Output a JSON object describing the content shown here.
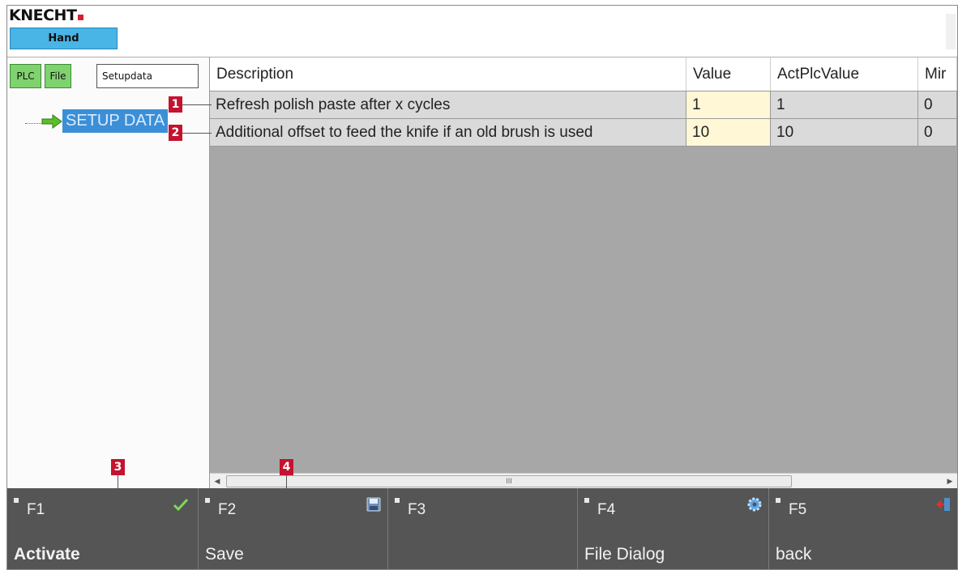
{
  "header": {
    "brand": "KNECHT",
    "mode": "Hand"
  },
  "tree_panel": {
    "plc_button": "PLC",
    "file_button": "File",
    "setup_tab": "Setupdata",
    "root_node": "SETUP DATA"
  },
  "table": {
    "columns": [
      "Description",
      "Value",
      "ActPlcValue",
      "Mir"
    ],
    "rows": [
      {
        "description": "Refresh polish paste after x cycles",
        "value": "1",
        "act": "1",
        "min": "0"
      },
      {
        "description": "Additional offset to feed the knife if an old brush is used",
        "value": "10",
        "act": "10",
        "min": "0"
      }
    ]
  },
  "scrollbar": {
    "thumb_grip": "III"
  },
  "callouts": [
    "1",
    "2",
    "3",
    "4"
  ],
  "function_keys": [
    {
      "key": "F1",
      "label": "Activate",
      "icon": "check-icon"
    },
    {
      "key": "F2",
      "label": "Save",
      "icon": "floppy-icon"
    },
    {
      "key": "F3",
      "label": "",
      "icon": ""
    },
    {
      "key": "F4",
      "label": "File Dialog",
      "icon": "gear-icon"
    },
    {
      "key": "F5",
      "label": "back",
      "icon": "exit-door-icon"
    }
  ],
  "colors": {
    "mode_badge": "#49b4e6",
    "green_button": "#7fd36e",
    "tree_selection": "#3c8fd6",
    "value_cell": "#fff7d6",
    "function_bar": "#555555",
    "callout": "#c4122f"
  }
}
